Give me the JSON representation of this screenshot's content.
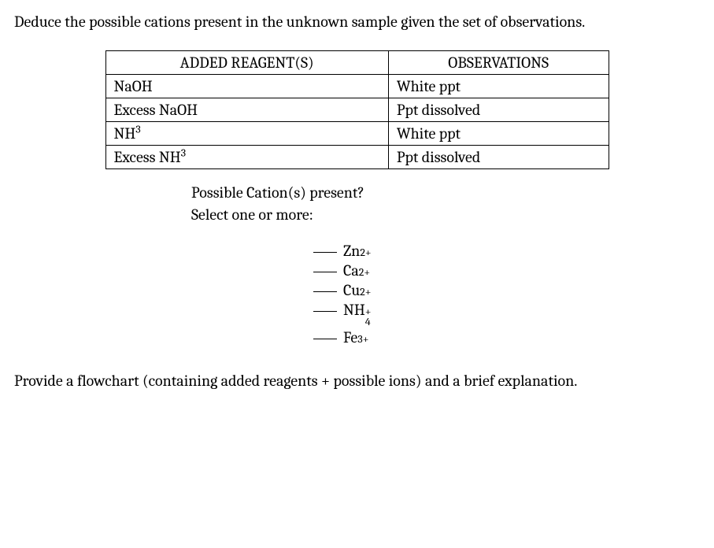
{
  "intro": "Deduce the possible cations present in the unknown sample given the set of observations.",
  "table": {
    "h1": "ADDED REAGENT(S)",
    "h2": "OBSERVATIONS",
    "rows": [
      {
        "r": "NaOH",
        "o": "White ppt"
      },
      {
        "r": "Excess NaOH",
        "o": "Ppt dissolved"
      },
      {
        "r": "NH",
        "rsup": "3",
        "o": "White ppt"
      },
      {
        "r": "Excess NH",
        "rsup": "3",
        "o": "Ppt dissolved"
      }
    ]
  },
  "prompt": {
    "q": "Possible Cation(s) present?",
    "sel": "Select one or more:"
  },
  "options": [
    {
      "sym": "Zn",
      "sup": "2+"
    },
    {
      "sym": "Ca",
      "sup": "2+"
    },
    {
      "sym": "Cu",
      "sup": "2+"
    },
    {
      "sym": "NH",
      "sub": "4",
      "sup": "+"
    },
    {
      "sym": "Fe",
      "sup": "3+"
    }
  ],
  "footer": "Provide a flowchart (containing added reagents + possible ions) and a brief explanation."
}
